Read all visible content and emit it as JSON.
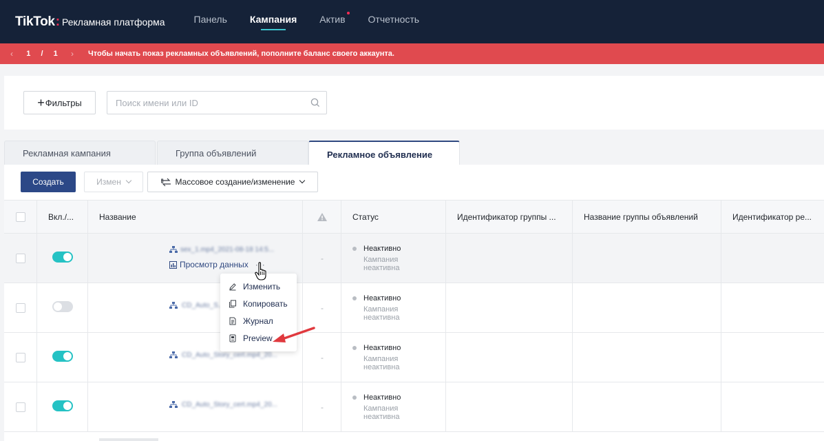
{
  "header": {
    "brand": "TikTok",
    "colon": ":",
    "subtitle": "Рекламная платформа",
    "nav": [
      {
        "label": "Панель"
      },
      {
        "label": "Кампания"
      },
      {
        "label": "Актив"
      },
      {
        "label": "Отчетность"
      }
    ],
    "active_nav": "Кампания"
  },
  "alert": {
    "prev": "‹",
    "next": "›",
    "pager": "1 / 1",
    "message": "Чтобы начать показ рекламных объявлений, пополните баланс своего аккаунта."
  },
  "filters": {
    "filter_button": "Фильтры",
    "search_placeholder": "Поиск имени или ID"
  },
  "tabs": [
    {
      "label": "Рекламная кампания"
    },
    {
      "label": "Группа объявлений"
    },
    {
      "label": "Рекламное объявление"
    }
  ],
  "active_tab": "Рекламное объявление",
  "toolbar": {
    "create": "Создать",
    "edit": "Измен",
    "mass": "Массовое создание/изменение"
  },
  "table": {
    "columns": [
      "Вкл./...",
      "Название",
      "Статус",
      "Идентификатор группы ...",
      "Название группы объявлений",
      "Идентификатор ре..."
    ],
    "rows": [
      {
        "enabled": true,
        "name": "sex_1.mp4_2021-08-18 14:5...",
        "view": "Просмотр данных",
        "dots": "···",
        "dash": "-",
        "status": "Неактивно",
        "status_sub": "Кампания неактивна"
      },
      {
        "enabled": false,
        "name": "CD_Auto_S...",
        "dash": "-",
        "status": "Неактивно",
        "status_sub": "Кампания неактивна"
      },
      {
        "enabled": true,
        "name": "CD_Auto_Story_cert.mp4_20...",
        "dash": "-",
        "status": "Неактивно",
        "status_sub": "Кампания неактивна"
      },
      {
        "enabled": true,
        "name": "CD_Auto_Story_cert.mp4_20...",
        "dash": "-",
        "status": "Неактивно",
        "status_sub": "Кампания неактивна"
      }
    ]
  },
  "menu": {
    "items": [
      {
        "label": "Изменить",
        "icon": "pencil-icon"
      },
      {
        "label": "Копировать",
        "icon": "copy-icon"
      },
      {
        "label": "Журнал",
        "icon": "log-icon"
      },
      {
        "label": "Preview",
        "icon": "preview-icon"
      }
    ]
  },
  "colors": {
    "nav_bg": "#152238",
    "alert_bg": "#e04a4f",
    "primary": "#2c4887",
    "toggle_on": "#25c2c4",
    "annotation_arrow": "#e0393e"
  }
}
